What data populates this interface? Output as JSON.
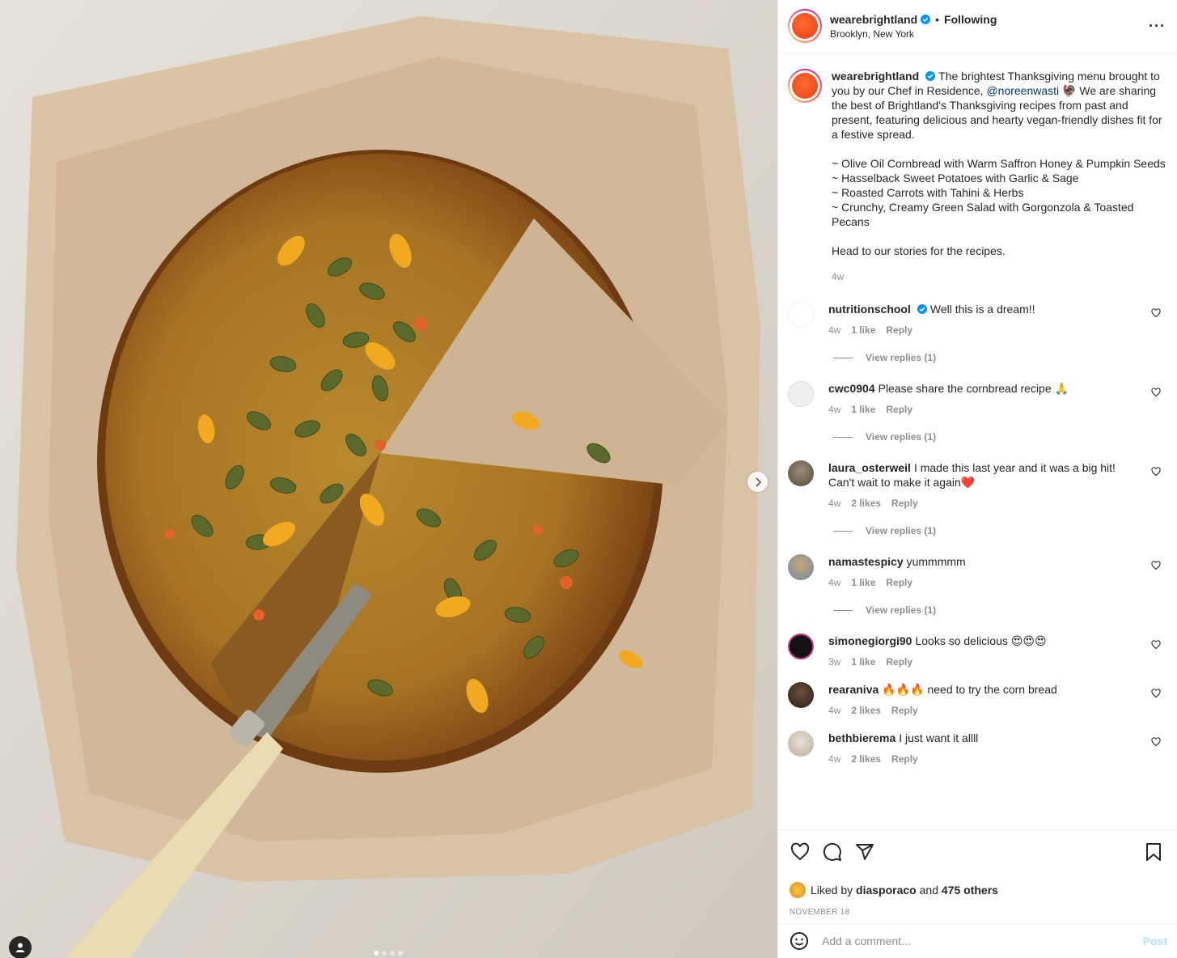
{
  "post": {
    "username": "wearebrightland",
    "follow_state": "Following",
    "separator": "•",
    "location": "Brooklyn, New York",
    "more_label": "···"
  },
  "caption": {
    "username": "wearebrightland",
    "text_before_mention": "The brightest Thanksgiving menu brought to you by our Chef in Residence,",
    "mention": "@noreenwasti",
    "text_after_mention": "🦃 We are sharing the best of Brightland's Thanksgiving recipes from past and present, featuring delicious and hearty vegan-friendly dishes fit for a festive spread.",
    "list": [
      "~ Olive Oil Cornbread with Warm Saffron Honey & Pumpkin Seeds",
      "~ Hasselback Sweet Potatoes with Garlic & Sage",
      "~ Roasted Carrots with Tahini & Herbs",
      "~ Crunchy, Creamy Green Salad with Gorgonzola & Toasted Pecans"
    ],
    "closing": "Head to our stories for the recipes.",
    "time": "4w"
  },
  "comments": [
    {
      "username": "nutritionschool",
      "verified": true,
      "text": "Well this is a dream!!",
      "time": "4w",
      "likes": "1 like",
      "reply": "Reply",
      "replies": "View replies (1)"
    },
    {
      "username": "cwc0904",
      "verified": false,
      "text": "Please share the cornbread recipe 🙏",
      "time": "4w",
      "likes": "1 like",
      "reply": "Reply",
      "replies": "View replies (1)"
    },
    {
      "username": "laura_osterweil",
      "verified": false,
      "text": "I made this last year and it was a big hit! Can't wait to make it again❤️",
      "time": "4w",
      "likes": "2 likes",
      "reply": "Reply",
      "replies": "View replies (1)"
    },
    {
      "username": "namastespicy",
      "verified": false,
      "text": "yummmmm",
      "time": "4w",
      "likes": "1 like",
      "reply": "Reply",
      "replies": "View replies (1)"
    },
    {
      "username": "simonegiorgi90",
      "verified": false,
      "text": "Looks so delicious 😍😍😍",
      "time": "3w",
      "likes": "1 like",
      "reply": "Reply",
      "replies": ""
    },
    {
      "username": "rearaniva",
      "verified": false,
      "text": "🔥🔥🔥 need to try the corn bread",
      "time": "4w",
      "likes": "2 likes",
      "reply": "Reply",
      "replies": ""
    },
    {
      "username": "bethbierema",
      "verified": false,
      "text": "I just want it allll",
      "time": "4w",
      "likes": "2 likes",
      "reply": "Reply",
      "replies": ""
    }
  ],
  "actions": {
    "icons": [
      "heart-icon",
      "comment-icon",
      "share-icon",
      "bookmark-icon"
    ],
    "liked_by_prefix": "Liked by",
    "liked_by_user": "diasporaco",
    "liked_by_joiner": "and",
    "liked_by_others": "475 others",
    "date": "NOVEMBER 18"
  },
  "composer": {
    "placeholder": "Add a comment...",
    "post_label": "Post",
    "emoji_icon": "emoji-icon"
  },
  "media": {
    "carousel_count": 4,
    "carousel_active": 1,
    "icons": [
      "chevron-right-icon",
      "user-tag-icon"
    ]
  },
  "colors": {
    "verified": "#0095f6",
    "link": "#00376b",
    "muted": "#8e8e8e",
    "post_disabled": "#b2dffc",
    "brand_orange": "#e8401a",
    "heart_red": "#ed4956"
  }
}
